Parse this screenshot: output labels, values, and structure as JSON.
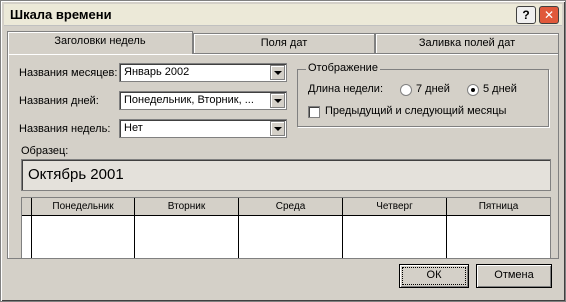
{
  "window": {
    "title": "Шкала времени",
    "help_label": "?",
    "close_label": "✕"
  },
  "tabs": [
    {
      "label": "Заголовки недель",
      "active": true
    },
    {
      "label": "Поля дат",
      "active": false
    },
    {
      "label": "Заливка полей дат",
      "active": false
    }
  ],
  "fields": {
    "month_names": {
      "label": "Названия месяцев:",
      "value": "Январь 2002"
    },
    "day_names": {
      "label": "Названия дней:",
      "value": "Понедельник, Вторник, ..."
    },
    "week_names": {
      "label": "Названия недель:",
      "value": "Нет"
    }
  },
  "display": {
    "group_title": "Отображение",
    "week_length_label": "Длина недели:",
    "options": [
      {
        "label": "7 дней",
        "selected": false
      },
      {
        "label": "5 дней",
        "selected": true
      }
    ],
    "prev_next_months_label": "Предыдущий и следующий месяцы",
    "prev_next_months_checked": false
  },
  "sample": {
    "label": "Образец:",
    "month_title": "Октябрь 2001",
    "weekdays": [
      "Понедельник",
      "Вторник",
      "Среда",
      "Четверг",
      "Пятница"
    ]
  },
  "buttons": {
    "ok": "ОК",
    "cancel": "Отмена"
  }
}
